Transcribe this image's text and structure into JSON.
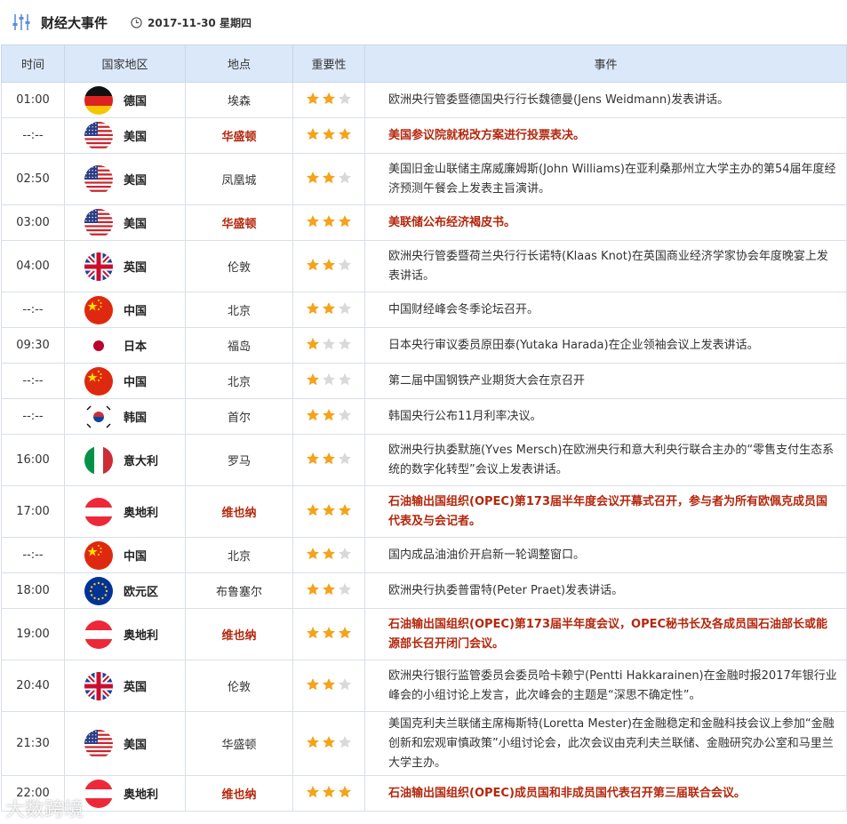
{
  "header": {
    "title": "财经大事件",
    "date": "2017-11-30 星期四"
  },
  "columns": [
    "时间",
    "国家地区",
    "地点",
    "重要性",
    "事件"
  ],
  "colors": {
    "important": "#b4270d",
    "star_on": "#f5a31b",
    "star_off": "#d9d9d9",
    "header_bg": "#dbe8fa"
  },
  "rows": [
    {
      "time": "01:00",
      "flag": "de",
      "country": "德国",
      "location": "埃森",
      "stars": 2,
      "important": false,
      "event": "欧洲央行管委暨德国央行行长魏德曼(Jens Weidmann)发表讲话。"
    },
    {
      "time": "--:--",
      "flag": "us",
      "country": "美国",
      "location": "华盛顿",
      "stars": 3,
      "important": true,
      "event": "美国参议院就税改方案进行投票表决。"
    },
    {
      "time": "02:50",
      "flag": "us",
      "country": "美国",
      "location": "凤凰城",
      "stars": 2,
      "important": false,
      "event": "美国旧金山联储主席威廉姆斯(John Williams)在亚利桑那州立大学主办的第54届年度经济预测午餐会上发表主旨演讲。"
    },
    {
      "time": "03:00",
      "flag": "us",
      "country": "美国",
      "location": "华盛顿",
      "stars": 3,
      "important": true,
      "event": "美联储公布经济褐皮书。"
    },
    {
      "time": "04:00",
      "flag": "uk",
      "country": "英国",
      "location": "伦敦",
      "stars": 2,
      "important": false,
      "event": "欧洲央行管委暨荷兰央行行长诺特(Klaas Knot)在英国商业经济学家协会年度晚宴上发表讲话。"
    },
    {
      "time": "--:--",
      "flag": "cn",
      "country": "中国",
      "location": "北京",
      "stars": 2,
      "important": false,
      "event": "中国财经峰会冬季论坛召开。"
    },
    {
      "time": "09:30",
      "flag": "jp",
      "country": "日本",
      "location": "福岛",
      "stars": 1,
      "important": false,
      "event": "日本央行审议委员原田泰(Yutaka Harada)在企业领袖会议上发表讲话。"
    },
    {
      "time": "--:--",
      "flag": "cn",
      "country": "中国",
      "location": "北京",
      "stars": 1,
      "important": false,
      "event": "第二届中国钢铁产业期货大会在京召开"
    },
    {
      "time": "--:--",
      "flag": "kr",
      "country": "韩国",
      "location": "首尔",
      "stars": 2,
      "important": false,
      "event": "韩国央行公布11月利率决议。"
    },
    {
      "time": "16:00",
      "flag": "it",
      "country": "意大利",
      "location": "罗马",
      "stars": 2,
      "important": false,
      "event": "欧洲央行执委默施(Yves Mersch)在欧洲央行和意大利央行联合主办的“零售支付生态系统的数字化转型”会议上发表讲话。"
    },
    {
      "time": "17:00",
      "flag": "at",
      "country": "奥地利",
      "location": "维也纳",
      "stars": 3,
      "important": true,
      "event": "石油输出国组织(OPEC)第173届半年度会议开幕式召开，参与者为所有欧佩克成员国代表及与会记者。"
    },
    {
      "time": "--:--",
      "flag": "cn",
      "country": "中国",
      "location": "北京",
      "stars": 2,
      "important": false,
      "event": "国内成品油油价开启新一轮调整窗口。"
    },
    {
      "time": "18:00",
      "flag": "eu",
      "country": "欧元区",
      "location": "布鲁塞尔",
      "stars": 2,
      "important": false,
      "event": "欧洲央行执委普雷特(Peter Praet)发表讲话。"
    },
    {
      "time": "19:00",
      "flag": "at",
      "country": "奥地利",
      "location": "维也纳",
      "stars": 3,
      "important": true,
      "event": "石油输出国组织(OPEC)第173届半年度会议，OPEC秘书长及各成员国石油部长或能源部长召开闭门会议。"
    },
    {
      "time": "20:40",
      "flag": "uk",
      "country": "英国",
      "location": "伦敦",
      "stars": 2,
      "important": false,
      "event": "欧洲央行银行监管委员会委员哈卡赖宁(Pentti Hakkarainen)在金融时报2017年银行业峰会的小组讨论上发言，此次峰会的主题是“深思不确定性”。"
    },
    {
      "time": "21:30",
      "flag": "us",
      "country": "美国",
      "location": "华盛顿",
      "stars": 2,
      "important": false,
      "event": "美国克利夫兰联储主席梅斯特(Loretta Mester)在金融稳定和金融科技会议上参加“金融创新和宏观审慎政策”小组讨论会，此次会议由克利夫兰联储、金融研究办公室和马里兰大学主办。"
    },
    {
      "time": "22:00",
      "flag": "at",
      "country": "奥地利",
      "location": "维也纳",
      "stars": 3,
      "important": true,
      "event": "石油输出国组织(OPEC)成员国和非成员国代表召开第三届联合会议。"
    }
  ],
  "watermark": "大数跨境"
}
